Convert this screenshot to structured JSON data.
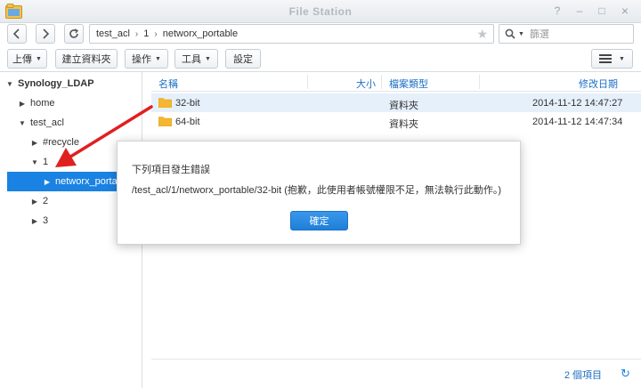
{
  "window": {
    "title": "File Station",
    "minimize_label": "?",
    "maximize_label": "–",
    "restore_label": "□",
    "close_label": "×"
  },
  "navigation": {
    "path": [
      "test_acl",
      "1",
      "networx_portable"
    ],
    "path_separator": "›",
    "search_placeholder": "篩選"
  },
  "toolbar": {
    "upload_label": "上傳",
    "create_folder_label": "建立資料夾",
    "action_label": "操作",
    "tools_label": "工具",
    "settings_label": "設定"
  },
  "tree": {
    "root": "Synology_LDAP",
    "items": [
      {
        "label": "home"
      },
      {
        "label": "test_acl"
      },
      {
        "label": "#recycle"
      },
      {
        "label": "1"
      },
      {
        "label": "networx_portable"
      },
      {
        "label": "2"
      },
      {
        "label": "3"
      }
    ]
  },
  "file_list": {
    "columns": [
      "名稱",
      "大小",
      "檔案類型",
      "修改日期"
    ],
    "rows": [
      {
        "name": "32-bit",
        "size": "",
        "type": "資料夾",
        "modified": "2014-11-12 14:47:27"
      },
      {
        "name": "64-bit",
        "size": "",
        "type": "資料夾",
        "modified": "2014-11-12 14:47:34"
      }
    ],
    "item_count": "2 個項目"
  },
  "dialog": {
    "title": "下列項目發生錯誤",
    "message": "/test_acl/1/networx_portable/32-bit (抱歉，此使用者帳號權限不足，無法執行此動作。)",
    "ok_label": "確定"
  },
  "colors": {
    "accent": "#1a82e2",
    "selection": "#e6f0fb",
    "arrow": "#e0201f",
    "folder": "#f5b731"
  }
}
